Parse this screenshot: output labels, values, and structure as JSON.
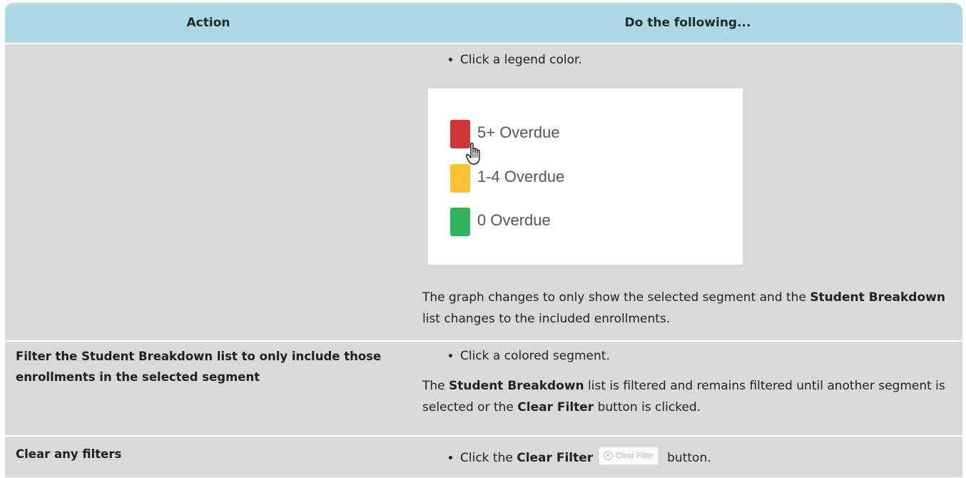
{
  "header": {
    "action": "Action",
    "instructions": "Do the following..."
  },
  "rows": [
    {
      "action": "",
      "bullet": "Click a legend color.",
      "legend": [
        {
          "label": "5+ Overdue",
          "color": "#d13438"
        },
        {
          "label": "1-4 Overdue",
          "color": "#ffc234"
        },
        {
          "label": "0 Overdue",
          "color": "#2db35e"
        }
      ],
      "result": {
        "t1": "The graph changes to only show the selected segment and the ",
        "b1": "Student Breakdown",
        "t2": " list changes to the included enrollments."
      }
    },
    {
      "action": "Filter the Student Breakdown list to only include those enrollments in the selected segment",
      "bullet": "Click a colored segment.",
      "result": {
        "t0": "The ",
        "b1": "Student Breakdown",
        "t1": " list is filtered and remains filtered until another segment is selected or the ",
        "b2": "Clear Filter",
        "t2": " button is clicked."
      }
    },
    {
      "action": "Clear any filters",
      "bullet_prefix": "Click the ",
      "bullet_bold": "Clear Filter",
      "button_label": "Clear Filter",
      "button_icon": "circle-x-icon",
      "bullet_suffix": "button."
    }
  ],
  "colors": {
    "header_bg": "#add8e6",
    "row_bg": "#d9d9d9"
  }
}
